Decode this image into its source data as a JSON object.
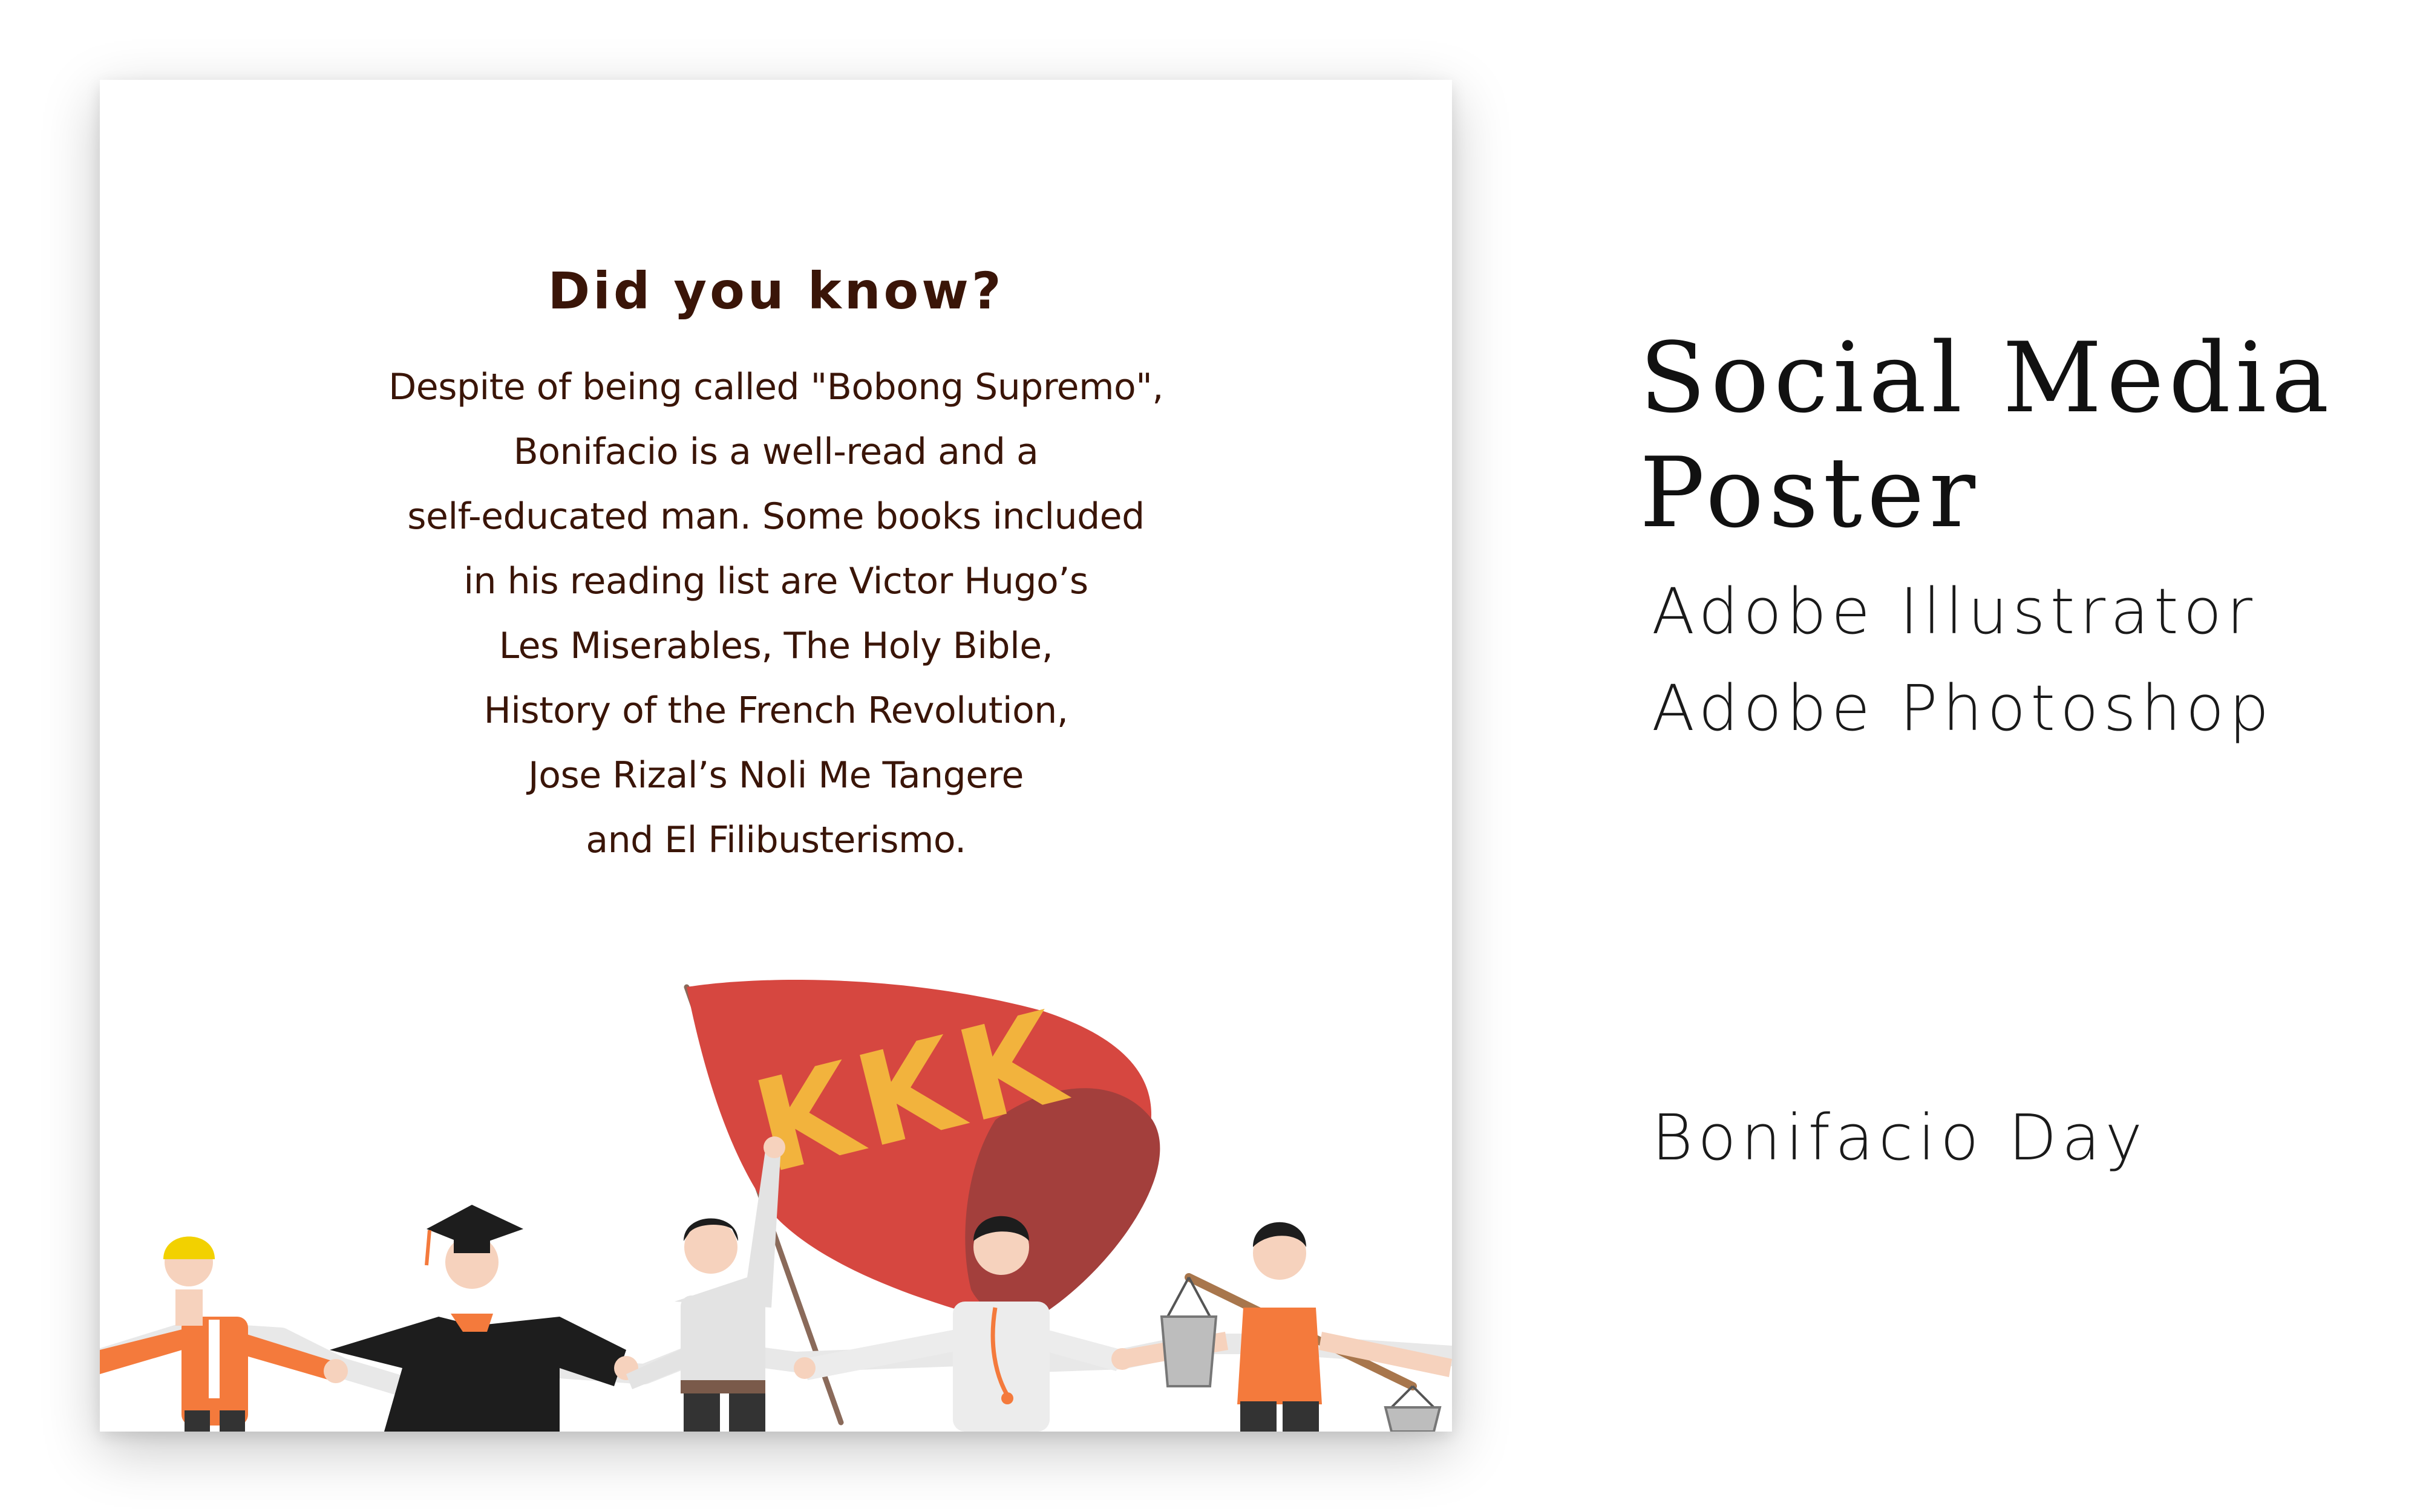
{
  "poster": {
    "heading": "Did you know?",
    "body_lines": [
      "Despite of being called \"Bobong Supremo\",",
      "Bonifacio is a well-read and a",
      "self-educated man. Some books included",
      "in his reading list are Victor Hugo’s",
      "Les Miserables, The Holy Bible,",
      "History of the French Revolution,",
      "Jose Rizal’s Noli Me Tangere",
      "and El Filibusterismo."
    ],
    "flag_text": "KKK",
    "colors": {
      "text": "#3a1508",
      "flag": "#d64740",
      "flag_shadow": "#a33f3c",
      "flag_letters": "#f2b33d",
      "accent_orange": "#f47a3c"
    }
  },
  "side": {
    "title": "Social Media Poster",
    "tools": [
      "Adobe Illustrator",
      "Adobe Photoshop"
    ],
    "project": "Bonifacio Day"
  }
}
